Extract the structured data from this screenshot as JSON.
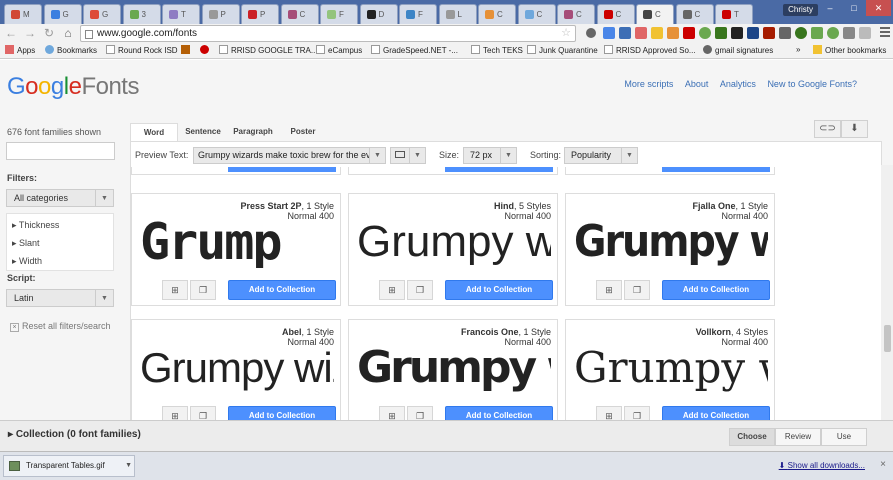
{
  "browser": {
    "user": "Christy",
    "url": "www.google.com/fonts",
    "tabs": [
      {
        "label": "M",
        "color": "#d14836"
      },
      {
        "label": "G",
        "color": "#3b7fe0"
      },
      {
        "label": "G",
        "color": "#dd4b39"
      },
      {
        "label": "3",
        "color": "#6aa84f"
      },
      {
        "label": "T",
        "color": "#8e7cc3"
      },
      {
        "label": "P",
        "color": "#999999"
      },
      {
        "label": "P",
        "color": "#cb2027"
      },
      {
        "label": "C",
        "color": "#a64d79"
      },
      {
        "label": "F",
        "color": "#93c47d"
      },
      {
        "label": "D",
        "color": "#222222"
      },
      {
        "label": "F",
        "color": "#3d85c6"
      },
      {
        "label": "L",
        "color": "#999999"
      },
      {
        "label": "C",
        "color": "#e69138"
      },
      {
        "label": "C",
        "color": "#6fa8dc"
      },
      {
        "label": "C",
        "color": "#a64d79"
      },
      {
        "label": "C",
        "color": "#cc0000"
      },
      {
        "label": "C",
        "color": "#444444"
      },
      {
        "label": "C",
        "color": "#666666"
      },
      {
        "label": "T",
        "color": "#cc0000"
      }
    ],
    "bookmarks": [
      {
        "label": "Apps"
      },
      {
        "label": "Bookmarks"
      },
      {
        "label": "Round Rock ISD"
      },
      {
        "label": ""
      },
      {
        "label": "RRISD GOOGLE TRA..."
      },
      {
        "label": "eCampus"
      },
      {
        "label": "GradeSpeed.NET -..."
      },
      {
        "label": "Tech TEKS"
      },
      {
        "label": "Junk Quarantine"
      },
      {
        "label": "RRISD Approved So..."
      },
      {
        "label": "gmail signatures"
      },
      {
        "label": "»"
      },
      {
        "label": "Other bookmarks"
      }
    ]
  },
  "header": {
    "logo_google": [
      "G",
      "o",
      "o",
      "g",
      "l",
      "e"
    ],
    "logo_fonts": "Fonts",
    "links": [
      "More scripts",
      "About",
      "Analytics",
      "New to Google Fonts?"
    ]
  },
  "sidebar": {
    "count": "676 font families shown",
    "search_placeholder": "",
    "filters_label": "Filters:",
    "category": "All categories",
    "filters": [
      "Thickness",
      "Slant",
      "Width"
    ],
    "script_label": "Script:",
    "script": "Latin",
    "reset": "Reset all filters/search"
  },
  "main": {
    "tabs": [
      "Word",
      "Sentence",
      "Paragraph",
      "Poster"
    ],
    "preview_text_label": "Preview Text:",
    "preview_text": "Grumpy wizards make toxic brew for the evil",
    "size_label": "Size:",
    "size": "72 px",
    "sorting_label": "Sorting:",
    "sorting": "Popularity",
    "add_label": "Add to Collection",
    "cards": [
      {
        "name": "Press Start 2P",
        "styles": ", 1 Style",
        "weight": "Normal 400",
        "sample": "Grump"
      },
      {
        "name": "Hind",
        "styles": ", 5 Styles",
        "weight": "Normal 400",
        "sample": "Grumpy w"
      },
      {
        "name": "Fjalla One",
        "styles": ", 1 Style",
        "weight": "Normal 400",
        "sample": "Grumpy wi"
      },
      {
        "name": "Abel",
        "styles": ", 1 Style",
        "weight": "Normal 400",
        "sample": "Grumpy wiz"
      },
      {
        "name": "Francois One",
        "styles": ", 1 Style",
        "weight": "Normal 400",
        "sample": "Grumpy wi"
      },
      {
        "name": "Vollkorn",
        "styles": ", 4 Styles",
        "weight": "Normal 400",
        "sample": "Grumpy w"
      }
    ]
  },
  "collection": {
    "title": "Collection (0 font families)",
    "buttons": [
      "Choose",
      "Review",
      "Use"
    ]
  },
  "downloads": {
    "file": "Transparent Tables.gif",
    "show_all": "Show all downloads...",
    "close": "×"
  },
  "colors": {
    "accent": "#4d90fe",
    "link": "#3b6fb5"
  }
}
